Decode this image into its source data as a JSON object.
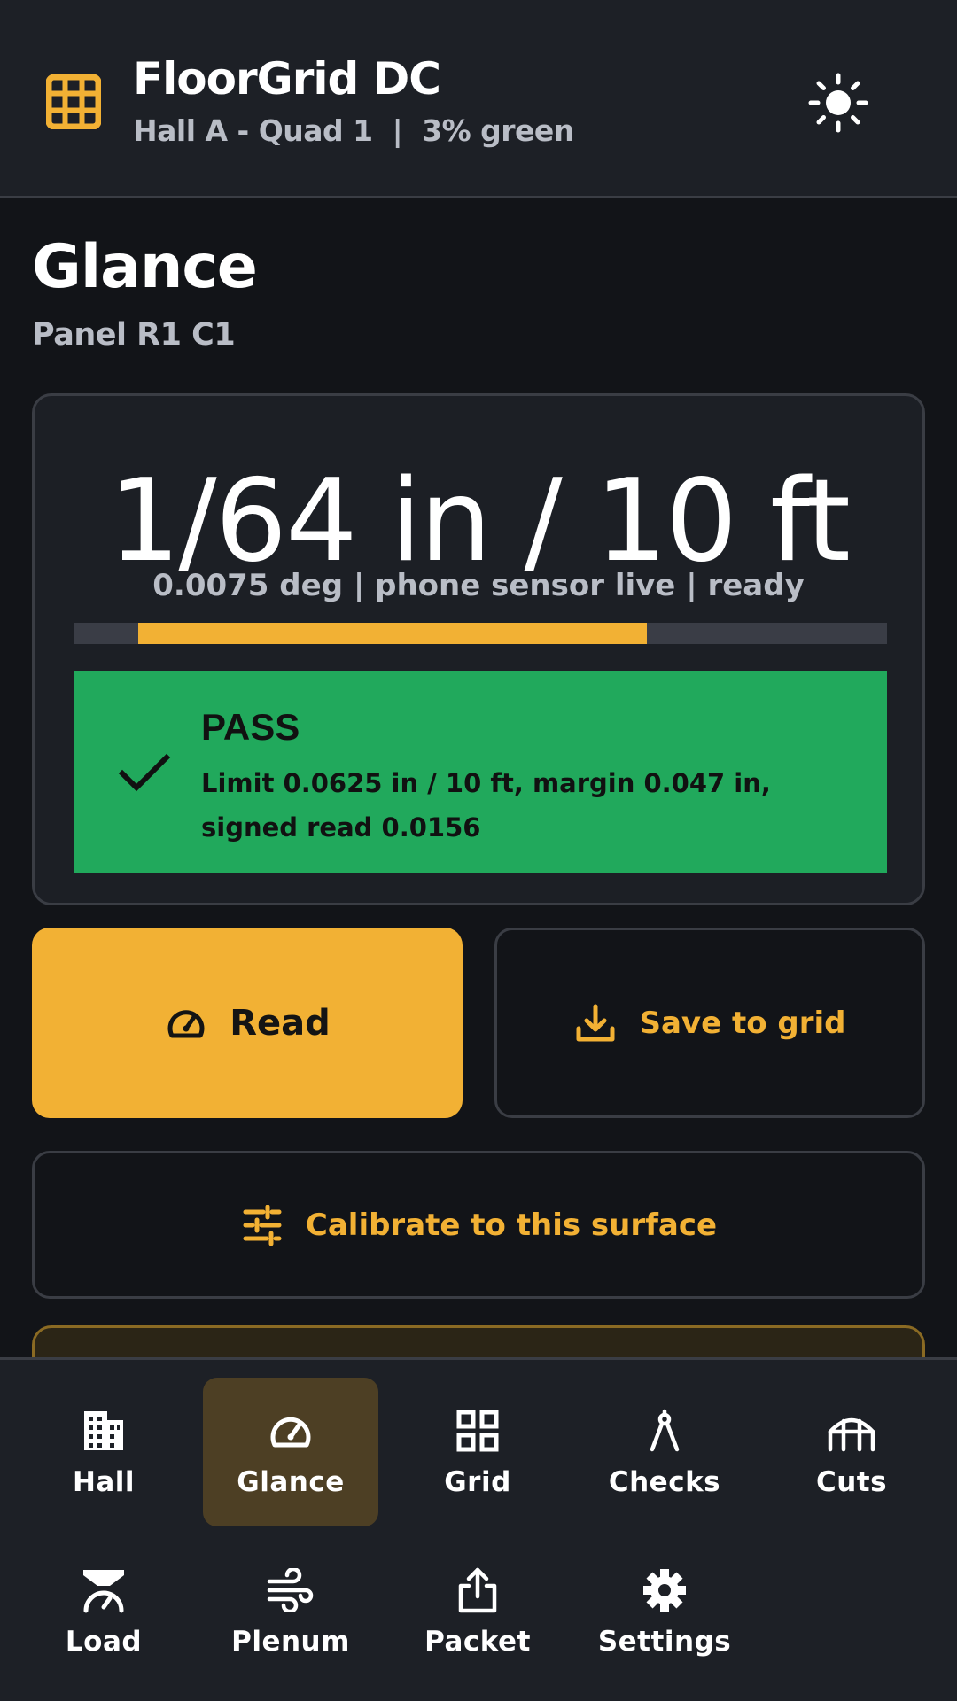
{
  "header": {
    "title": "FloorGrid DC",
    "subtitle": "Hall A - Quad 1  |  3% green"
  },
  "page": {
    "title": "Glance",
    "subtitle": "Panel R1 C1"
  },
  "reading": {
    "value": "1/64 in / 10 ft",
    "detail": "0.0075 deg | phone sensor live | ready",
    "bar_start": 0.08,
    "bar_end": 0.705
  },
  "status": {
    "title": "PASS",
    "detail": "Limit 0.0625 in / 10 ft, margin 0.047 in, signed read 0.0156"
  },
  "actions": {
    "read": "Read",
    "save": "Save to grid",
    "calibrate": "Calibrate to this surface"
  },
  "nav": {
    "items": [
      {
        "label": "Hall",
        "icon": "building-icon"
      },
      {
        "label": "Glance",
        "icon": "gauge-icon",
        "active": true
      },
      {
        "label": "Grid",
        "icon": "grid-icon"
      },
      {
        "label": "Checks",
        "icon": "compass-icon"
      },
      {
        "label": "Cuts",
        "icon": "bridge-icon"
      },
      {
        "label": "Load",
        "icon": "load-icon"
      },
      {
        "label": "Plenum",
        "icon": "wind-icon"
      },
      {
        "label": "Packet",
        "icon": "share-icon"
      },
      {
        "label": "Settings",
        "icon": "gear-icon"
      }
    ]
  },
  "colors": {
    "accent": "#f2b134",
    "pass": "#21a95c",
    "background": "#121418",
    "surface": "#1d2026"
  }
}
